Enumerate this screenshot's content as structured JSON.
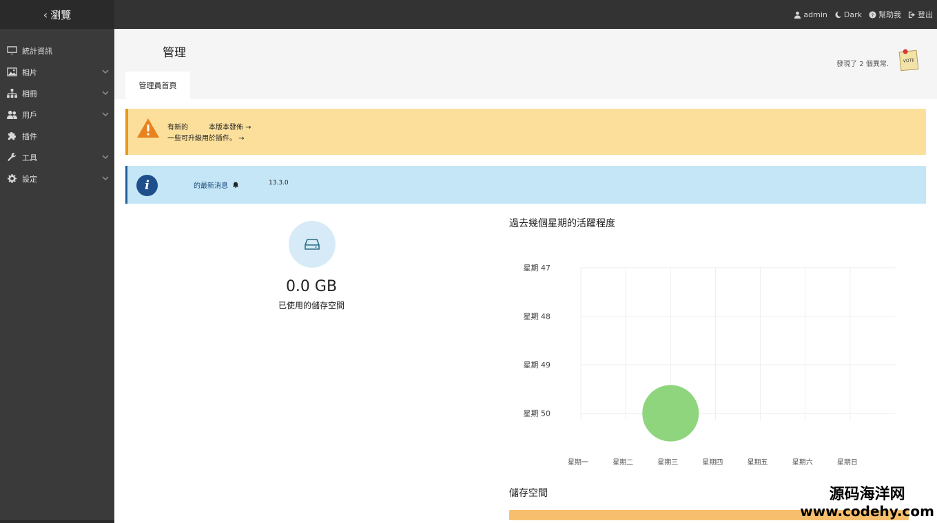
{
  "app": {
    "back_label": "瀏覽"
  },
  "topnav": {
    "user": "admin",
    "theme": "Dark",
    "help": "幫助我",
    "logout": "登出"
  },
  "sidebar": {
    "items": [
      {
        "label": "統計資訊",
        "icon": "monitor-icon",
        "expandable": false
      },
      {
        "label": "相片",
        "icon": "image-icon",
        "expandable": true
      },
      {
        "label": "相冊",
        "icon": "sitemap-icon",
        "expandable": true
      },
      {
        "label": "用戶",
        "icon": "users-icon",
        "expandable": true
      },
      {
        "label": "插件",
        "icon": "puzzle-icon",
        "expandable": false
      },
      {
        "label": "工具",
        "icon": "wrench-icon",
        "expandable": true
      },
      {
        "label": "設定",
        "icon": "gear-icon",
        "expandable": true
      }
    ]
  },
  "header": {
    "title": "管理",
    "tab": "管理員首頁",
    "errors": "發現了 2 個異常.",
    "vote": "VOTE"
  },
  "alerts": {
    "warning_line1_a": "有新的",
    "warning_line1_b": "本版本發佈 →",
    "warning_line2": "一些可升級用於插件。 →",
    "info_text": "的最新消息",
    "info_version": "13.3.0"
  },
  "storage": {
    "value": "0.0 GB",
    "label": "已使用的儲存空間"
  },
  "chart_title": "過去幾個星期的活躍程度",
  "storage_section_title": "儲存空間",
  "chart_data": {
    "type": "scatter",
    "title": "過去幾個星期的活躍程度",
    "y_categories": [
      "星期 47",
      "星期 48",
      "星期 49",
      "星期 50"
    ],
    "x_categories": [
      "星期一",
      "星期二",
      "星期三",
      "星期四",
      "星期五",
      "星期六",
      "星期日"
    ],
    "points": [
      {
        "x": "星期三",
        "y": "星期 50",
        "size": 1
      }
    ],
    "grid": true,
    "colors": {
      "point": "#8ed57d",
      "grid": "#eeeeee"
    }
  },
  "watermark": {
    "cn": "源码海洋网",
    "url": "www.codehy.com"
  },
  "colors": {
    "topbar": "#333333",
    "sidebar": "#3a3a3a",
    "warning_bg": "#fbdf9b",
    "warning_border": "#e79a1c",
    "info_bg": "#c5e6f6",
    "info_border": "#1f5f97"
  }
}
